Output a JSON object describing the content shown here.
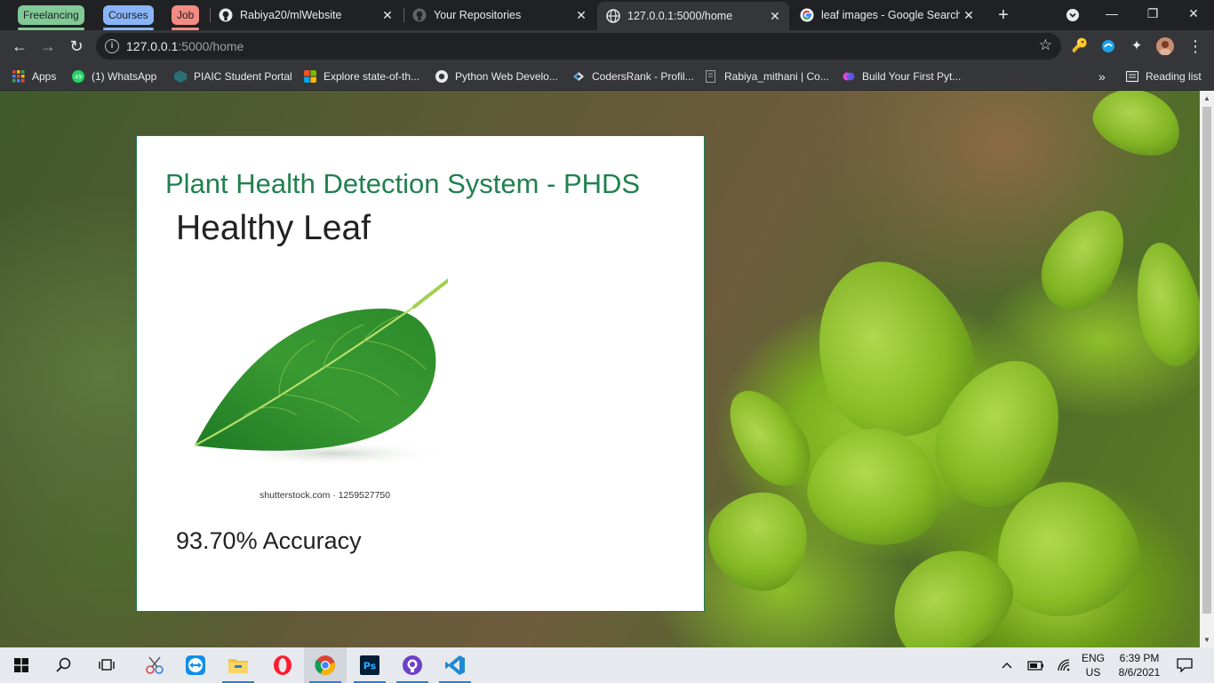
{
  "browser": {
    "tab_groups": [
      {
        "label": "Freelancing",
        "color": "#81c995"
      },
      {
        "label": "Courses",
        "color": "#8ab4f8"
      },
      {
        "label": "Job",
        "color": "#f28b82"
      }
    ],
    "tabs": [
      {
        "title": "Rabiya20/mlWebsite",
        "icon": "github-icon",
        "active": false
      },
      {
        "title": "Your Repositories",
        "icon": "github-icon",
        "active": false
      },
      {
        "title": "127.0.0.1:5000/home",
        "icon": "globe-icon",
        "active": true
      },
      {
        "title": "leaf images - Google Search",
        "icon": "google-icon",
        "active": false
      }
    ],
    "address": {
      "host": "127.0.0.1",
      "path": ":5000/home"
    },
    "bookmarks": [
      {
        "label": "Apps",
        "icon": "apps-grid-icon"
      },
      {
        "label": "(1) WhatsApp",
        "icon": "whatsapp-icon"
      },
      {
        "label": "PIAIC Student Portal",
        "icon": "piaic-icon"
      },
      {
        "label": "Explore state-of-th...",
        "icon": "microsoft-icon"
      },
      {
        "label": "Python Web Develo...",
        "icon": "python-icon"
      },
      {
        "label": "CodersRank - Profil...",
        "icon": "codersrank-icon"
      },
      {
        "label": "Rabiya_mithani | Co...",
        "icon": "page-icon"
      },
      {
        "label": "Build Your First Pyt...",
        "icon": "build-icon"
      }
    ],
    "bookmarks_more": "»",
    "reading_list": "Reading list"
  },
  "page": {
    "title": "Plant Health Detection System - PHDS",
    "result": "Healthy Leaf",
    "image_caption": "shutterstock.com · 1259527750",
    "accuracy": "93.70% Accuracy"
  },
  "taskbar": {
    "language": "ENG",
    "region": "US",
    "time": "6:39 PM",
    "date": "8/6/2021"
  }
}
